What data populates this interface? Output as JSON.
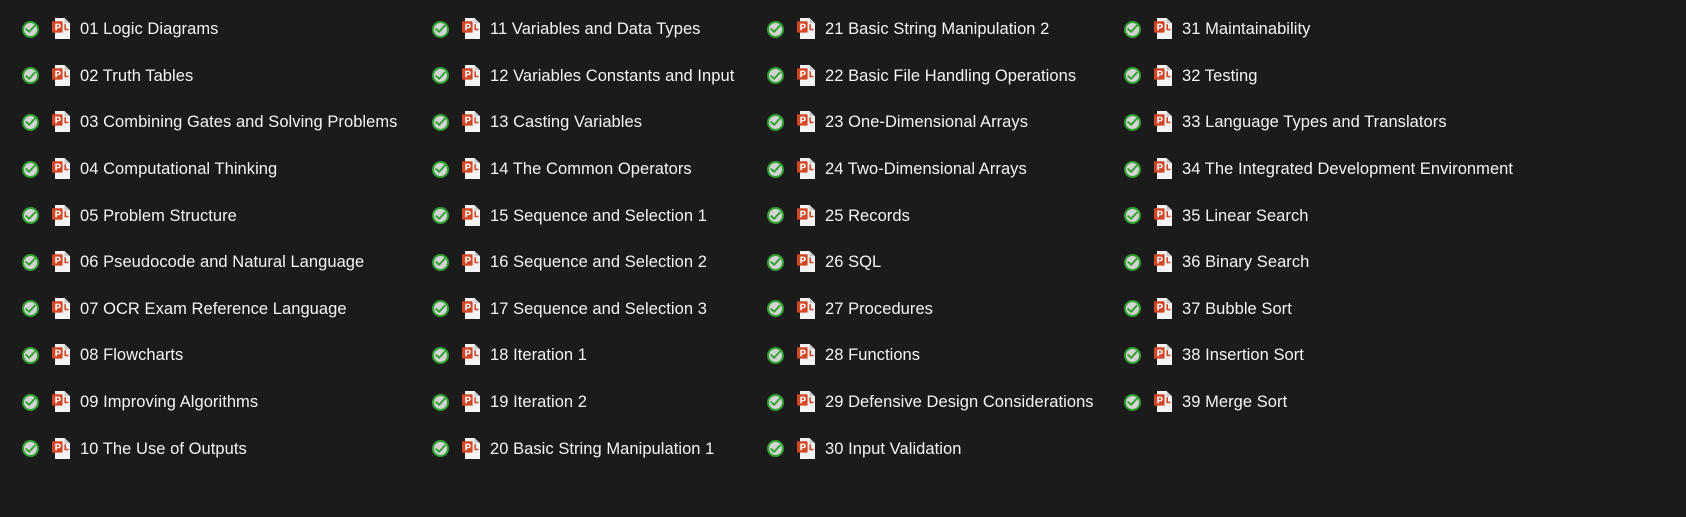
{
  "window": {
    "background_color": "#1b1b1b",
    "text_color": "#f4f4f4",
    "view": "file-explorer-list"
  },
  "icons": {
    "sync_badge": "green-check-circle-icon",
    "file_type": "powerpoint-file-icon",
    "powerpoint_red": "#d24726",
    "sync_green": "#2ea12e"
  },
  "columns": [
    {
      "name": "column-1",
      "files": [
        {
          "name": "01 Logic Diagrams",
          "status": "synced",
          "type": "pptx"
        },
        {
          "name": "02 Truth Tables",
          "status": "synced",
          "type": "pptx"
        },
        {
          "name": "03 Combining Gates and Solving Problems",
          "status": "synced",
          "type": "pptx"
        },
        {
          "name": "04 Computational Thinking",
          "status": "synced",
          "type": "pptx"
        },
        {
          "name": "05 Problem Structure",
          "status": "synced",
          "type": "pptx"
        },
        {
          "name": "06 Pseudocode and Natural Language",
          "status": "synced",
          "type": "pptx"
        },
        {
          "name": "07 OCR Exam Reference Language",
          "status": "synced",
          "type": "pptx"
        },
        {
          "name": "08 Flowcharts",
          "status": "synced",
          "type": "pptx"
        },
        {
          "name": "09 Improving Algorithms",
          "status": "synced",
          "type": "pptx"
        },
        {
          "name": "10 The Use of Outputs",
          "status": "synced",
          "type": "pptx"
        }
      ]
    },
    {
      "name": "column-2",
      "files": [
        {
          "name": "11 Variables and Data Types",
          "status": "synced",
          "type": "pptx"
        },
        {
          "name": "12 Variables Constants and Input",
          "status": "synced",
          "type": "pptx"
        },
        {
          "name": "13 Casting Variables",
          "status": "synced",
          "type": "pptx"
        },
        {
          "name": "14 The Common Operators",
          "status": "synced",
          "type": "pptx"
        },
        {
          "name": "15 Sequence and Selection 1",
          "status": "synced",
          "type": "pptx"
        },
        {
          "name": "16 Sequence and Selection 2",
          "status": "synced",
          "type": "pptx"
        },
        {
          "name": "17 Sequence and Selection 3",
          "status": "synced",
          "type": "pptx"
        },
        {
          "name": "18 Iteration 1",
          "status": "synced",
          "type": "pptx"
        },
        {
          "name": "19 Iteration 2",
          "status": "synced",
          "type": "pptx"
        },
        {
          "name": "20 Basic String Manipulation 1",
          "status": "synced",
          "type": "pptx"
        }
      ]
    },
    {
      "name": "column-3",
      "files": [
        {
          "name": "21 Basic String Manipulation 2",
          "status": "synced",
          "type": "pptx"
        },
        {
          "name": "22 Basic File Handling Operations",
          "status": "synced",
          "type": "pptx"
        },
        {
          "name": "23 One-Dimensional Arrays",
          "status": "synced",
          "type": "pptx"
        },
        {
          "name": "24 Two-Dimensional Arrays",
          "status": "synced",
          "type": "pptx"
        },
        {
          "name": "25 Records",
          "status": "synced",
          "type": "pptx"
        },
        {
          "name": "26 SQL",
          "status": "synced",
          "type": "pptx"
        },
        {
          "name": "27 Procedures",
          "status": "synced",
          "type": "pptx"
        },
        {
          "name": "28 Functions",
          "status": "synced",
          "type": "pptx"
        },
        {
          "name": "29 Defensive Design Considerations",
          "status": "synced",
          "type": "pptx"
        },
        {
          "name": "30 Input Validation",
          "status": "synced",
          "type": "pptx"
        }
      ]
    },
    {
      "name": "column-4",
      "files": [
        {
          "name": "31 Maintainability",
          "status": "synced",
          "type": "pptx"
        },
        {
          "name": "32 Testing",
          "status": "synced",
          "type": "pptx"
        },
        {
          "name": "33 Language Types and Translators",
          "status": "synced",
          "type": "pptx"
        },
        {
          "name": "34 The Integrated Development Environment",
          "status": "synced",
          "type": "pptx"
        },
        {
          "name": "35 Linear Search",
          "status": "synced",
          "type": "pptx"
        },
        {
          "name": "36 Binary Search",
          "status": "synced",
          "type": "pptx"
        },
        {
          "name": "37 Bubble Sort",
          "status": "synced",
          "type": "pptx"
        },
        {
          "name": "38 Insertion Sort",
          "status": "synced",
          "type": "pptx"
        },
        {
          "name": "39 Merge Sort",
          "status": "synced",
          "type": "pptx"
        }
      ]
    }
  ]
}
